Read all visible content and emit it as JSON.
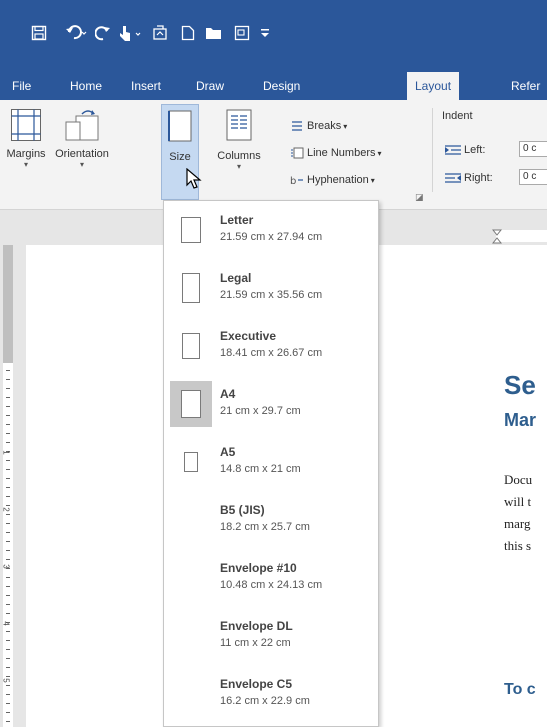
{
  "colors": {
    "accent": "#2b579a",
    "heading": "#2e5e8e",
    "selected": "#c8c8c8"
  },
  "quick_access": {
    "icons": [
      "save-icon",
      "undo-icon",
      "redo-icon",
      "touch-mode-icon",
      "format-icon",
      "new-document-icon",
      "open-icon",
      "print-preview-icon",
      "customize-icon"
    ]
  },
  "tabs": [
    "File",
    "Home",
    "Insert",
    "Draw",
    "Design",
    "Layout",
    "Refer"
  ],
  "ribbon": {
    "margins_label": "Margins",
    "orientation_label": "Orientation",
    "size_label": "Size",
    "columns_label": "Columns",
    "breaks_label": "Breaks",
    "line_numbers_label": "Line Numbers",
    "hyphenation_label": "Hyphenation",
    "indent_label": "Indent",
    "left_label": "Left:",
    "right_label": "Right:",
    "left_value": "0 c",
    "right_value": "0 c"
  },
  "size_menu": {
    "items": [
      {
        "name": "Letter",
        "dim": "21.59 cm x 27.94 cm"
      },
      {
        "name": "Legal",
        "dim": "21.59 cm x 35.56 cm"
      },
      {
        "name": "Executive",
        "dim": "18.41 cm x 26.67 cm"
      },
      {
        "name": "A4",
        "dim": "21 cm x 29.7 cm",
        "selected": true
      },
      {
        "name": "A5",
        "dim": "14.8 cm x 21 cm"
      },
      {
        "name": "B5 (JIS)",
        "dim": "18.2 cm x 25.7 cm"
      },
      {
        "name": "Envelope #10",
        "dim": "10.48 cm x 24.13 cm"
      },
      {
        "name": "Envelope DL",
        "dim": "11 cm x 22 cm"
      },
      {
        "name": "Envelope C5",
        "dim": "16.2 cm x 22.9 cm"
      }
    ]
  },
  "document": {
    "heading": "Se",
    "subheading": "Mar",
    "lines": [
      "Docu",
      "will t",
      "marg",
      "this s"
    ],
    "subheading2": "To c"
  },
  "vruler_numbers": [
    "1",
    "2",
    "3",
    "4",
    "5",
    "6"
  ]
}
